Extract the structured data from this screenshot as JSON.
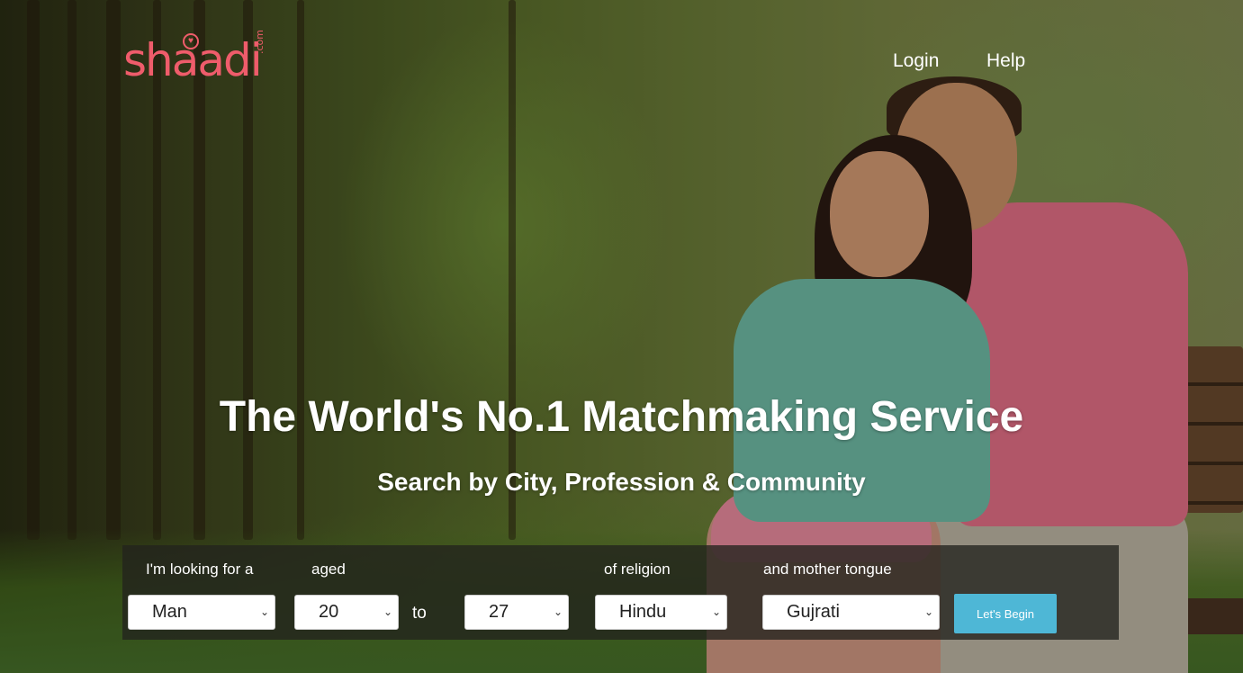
{
  "brand": {
    "logo_main": "shaadi",
    "logo_suffix": ".com",
    "accent": "#ef5c6b"
  },
  "header": {
    "login": "Login",
    "help": "Help"
  },
  "hero": {
    "headline": "The World's No.1 Matchmaking Service",
    "subline": "Search by City, Profession & Community"
  },
  "search": {
    "looking_for_label": "I'm looking for a",
    "aged_label": "aged",
    "religion_label": "of religion",
    "tongue_label": "and mother tongue",
    "to_label": "to",
    "looking_for_value": "Man",
    "age_from_value": "20",
    "age_to_value": "27",
    "religion_value": "Hindu",
    "tongue_value": "Gujrati",
    "submit_label": "Let's Begin",
    "button_color": "#4eb7d6"
  },
  "icons": {
    "dropdown": "chevron-down-icon",
    "logo_heart": "heart-icon"
  }
}
